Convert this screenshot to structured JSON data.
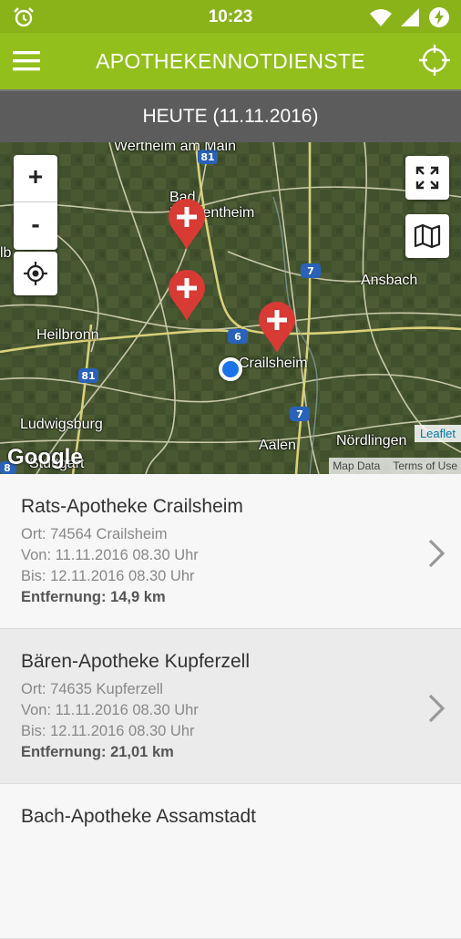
{
  "status_bar": {
    "time": "10:23"
  },
  "app_bar": {
    "title": "APOTHEKENNOTDIENSTE"
  },
  "date_bar": {
    "text": "HEUTE (11.11.2016)"
  },
  "map": {
    "zoom_in": "+",
    "zoom_out": "-",
    "labels": {
      "wertheim": "Wertheim am Main",
      "mergentheim": "Bad Mergentheim",
      "ansbach": "Ansbach",
      "heilbronn": "Heilbronn",
      "crailsheim": "Crailsheim",
      "ludwigsburg": "Ludwigsburg",
      "aalen": "Aalen",
      "noerdlingen": "Nördlingen",
      "stuttgart": "Stuttgart",
      "lb": "lb"
    },
    "road_numbers": {
      "a81_top": "81",
      "a7_mid": "7",
      "a6": "6",
      "a81_low": "81",
      "a7_low": "7",
      "a8": "8"
    },
    "leaflet": "Leaflet",
    "map_data": "Map Data",
    "terms": "Terms of Use",
    "google": "Google"
  },
  "pharmacies": [
    {
      "name": "Rats-Apotheke Crailsheim",
      "ort": "Ort: 74564 Crailsheim",
      "von": "Von: 11.11.2016 08.30 Uhr",
      "bis": "Bis: 12.11.2016 08.30 Uhr",
      "entfernung": "Entfernung: 14,9 km"
    },
    {
      "name": "Bären-Apotheke Kupferzell",
      "ort": "Ort: 74635 Kupferzell",
      "von": "Von: 11.11.2016 08.30 Uhr",
      "bis": "Bis: 12.11.2016 08.30 Uhr",
      "entfernung": "Entfernung: 21,01 km"
    },
    {
      "name": "Bach-Apotheke Assamstadt"
    }
  ],
  "colors": {
    "accent": "#93bf1c",
    "status": "#8ab319",
    "date_bar": "#5c5c5c",
    "pin": "#d83a34",
    "location": "#1a73e8"
  },
  "icons": [
    "alarm-icon",
    "wifi-icon",
    "signal-icon",
    "battery-icon",
    "menu-icon",
    "crosshair-icon",
    "locate-me-icon",
    "fullscreen-icon",
    "map-layers-icon",
    "pharmacy-pin-icon",
    "chevron-right-icon"
  ]
}
